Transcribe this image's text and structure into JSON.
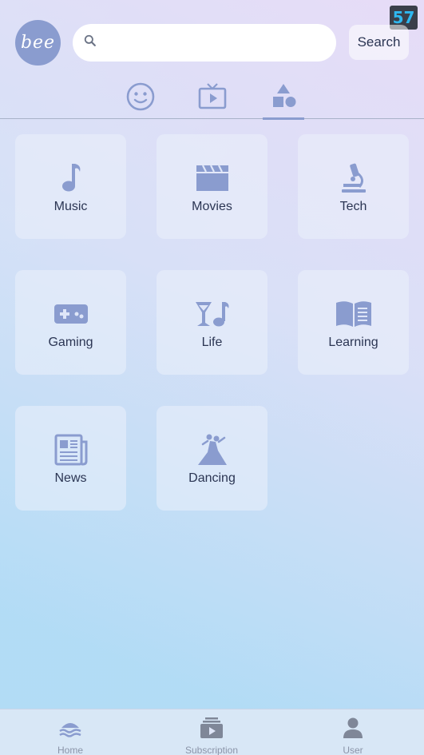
{
  "status": {
    "badge": "57"
  },
  "header": {
    "logo_text": "bee",
    "search": {
      "value": "",
      "placeholder": ""
    },
    "search_button_label": "Search"
  },
  "tabs": [
    {
      "name": "emoji",
      "icon": "smiley-icon"
    },
    {
      "name": "video",
      "icon": "tv-play-icon"
    },
    {
      "name": "categories",
      "icon": "shapes-icon",
      "active": true
    }
  ],
  "categories": [
    {
      "label": "Music",
      "icon": "music-note-icon"
    },
    {
      "label": "Movies",
      "icon": "clapperboard-icon"
    },
    {
      "label": "Tech",
      "icon": "microscope-icon"
    },
    {
      "label": "Gaming",
      "icon": "gamepad-icon"
    },
    {
      "label": "Life",
      "icon": "cocktail-music-icon"
    },
    {
      "label": "Learning",
      "icon": "open-book-icon"
    },
    {
      "label": "News",
      "icon": "newspaper-icon"
    },
    {
      "label": "Dancing",
      "icon": "dancers-icon"
    }
  ],
  "bottom_nav": [
    {
      "label": "Home",
      "icon": "home-waves-icon"
    },
    {
      "label": "Subscription",
      "icon": "subscription-icon"
    },
    {
      "label": "User",
      "icon": "user-icon"
    }
  ],
  "colors": {
    "accent": "#8a9ccf",
    "text": "#2b3553",
    "muted": "#8a94a8",
    "badge_text": "#2fb8f0"
  }
}
